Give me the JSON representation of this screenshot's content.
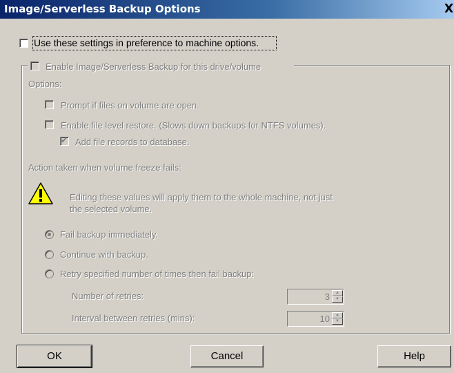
{
  "window": {
    "title": "Image/Serverless Backup Options",
    "close_glyph": "X"
  },
  "use_settings": {
    "label": "Use these settings in preference to machine options.",
    "checked": false
  },
  "enable_backup": {
    "label": "Enable Image/Serverless Backup for this drive/volume",
    "checked": false
  },
  "options_label": "Options:",
  "prompt_open": {
    "label": "Prompt if files on volume are open.",
    "checked": false
  },
  "file_level_restore": {
    "label": "Enable file level restore. (Slows down backups for NTFS volumes).",
    "checked": false
  },
  "add_file_records": {
    "label": "Add file records to database.",
    "checked": true
  },
  "freeze_label": "Action taken when volume freeze fails:",
  "warning": {
    "icon": "warning-icon",
    "line1": "Editing these values will apply them to the whole machine, not just",
    "line2": "the selected volume."
  },
  "radios": [
    {
      "label": "Fail backup immediately.",
      "selected": true
    },
    {
      "label": "Continue with backup.",
      "selected": false
    },
    {
      "label": "Retry specified number of times then fail backup:",
      "selected": false
    }
  ],
  "retries": {
    "label": "Number of retries:",
    "value": "3"
  },
  "interval": {
    "label": "Interval between retries (mins):",
    "value": "10"
  },
  "buttons": {
    "ok": "OK",
    "cancel": "Cancel",
    "help": "Help"
  }
}
